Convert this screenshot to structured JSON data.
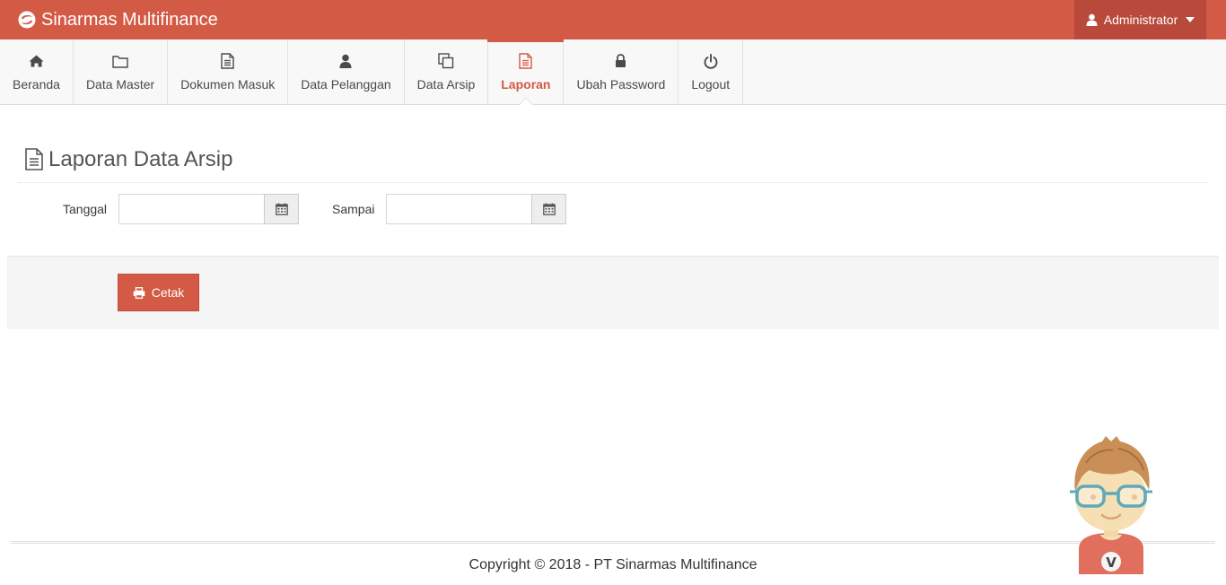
{
  "app": {
    "brand": "Sinarmas Multifinance"
  },
  "user_menu": {
    "label": "Administrator"
  },
  "nav": {
    "items": [
      {
        "label": "Beranda",
        "icon": "home-icon"
      },
      {
        "label": "Data Master",
        "icon": "folder-icon"
      },
      {
        "label": "Dokumen Masuk",
        "icon": "file-text-icon"
      },
      {
        "label": "Data Pelanggan",
        "icon": "user-icon"
      },
      {
        "label": "Data Arsip",
        "icon": "copy-icon"
      },
      {
        "label": "Laporan",
        "icon": "file-text-icon",
        "active": true
      },
      {
        "label": "Ubah Password",
        "icon": "lock-icon"
      },
      {
        "label": "Logout",
        "icon": "power-icon"
      }
    ]
  },
  "page": {
    "title": "Laporan Data Arsip"
  },
  "form": {
    "tanggal_label": "Tanggal",
    "tanggal_value": "",
    "sampai_label": "Sampai",
    "sampai_value": "",
    "print_label": "Cetak"
  },
  "footer": {
    "copyright": "Copyright © 2018 - PT Sinarmas Multifinance"
  },
  "colors": {
    "accent": "#d35a45",
    "accent_dark": "#b9493a"
  }
}
